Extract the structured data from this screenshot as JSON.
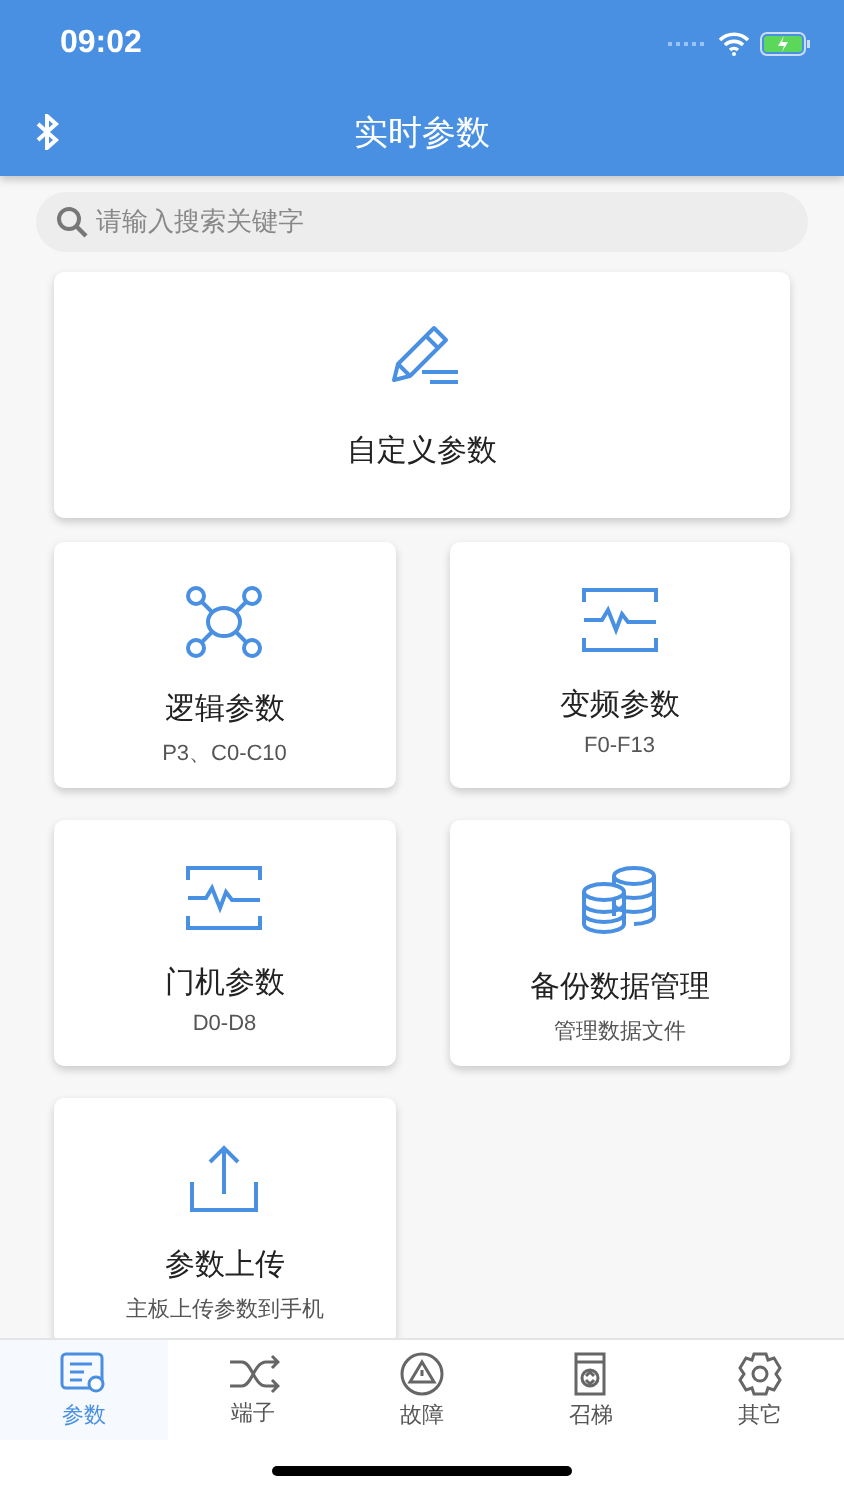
{
  "status_bar": {
    "time": "09:02"
  },
  "nav_bar": {
    "title": "实时参数"
  },
  "search": {
    "placeholder": "请输入搜索关键字"
  },
  "featured_card": {
    "kind": "pencil",
    "title": "自定义参数"
  },
  "cards": [
    {
      "kind": "network",
      "title": "逻辑参数",
      "subtitle": "P3、C0-C10"
    },
    {
      "kind": "waveform",
      "title": "变频参数",
      "subtitle": "F0-F13"
    },
    {
      "kind": "waveform",
      "title": "门机参数",
      "subtitle": "D0-D8"
    },
    {
      "kind": "database",
      "title": "备份数据管理",
      "subtitle": "管理数据文件"
    },
    {
      "kind": "upload",
      "title": "参数上传",
      "subtitle": "主板上传参数到手机"
    }
  ],
  "tabs": [
    {
      "kind": "params",
      "label": "参数",
      "selected": true
    },
    {
      "kind": "shuffle",
      "label": "端子",
      "selected": false
    },
    {
      "kind": "warning",
      "label": "故障",
      "selected": false
    },
    {
      "kind": "elevator",
      "label": "召梯",
      "selected": false
    },
    {
      "kind": "gear",
      "label": "其它",
      "selected": false
    }
  ]
}
